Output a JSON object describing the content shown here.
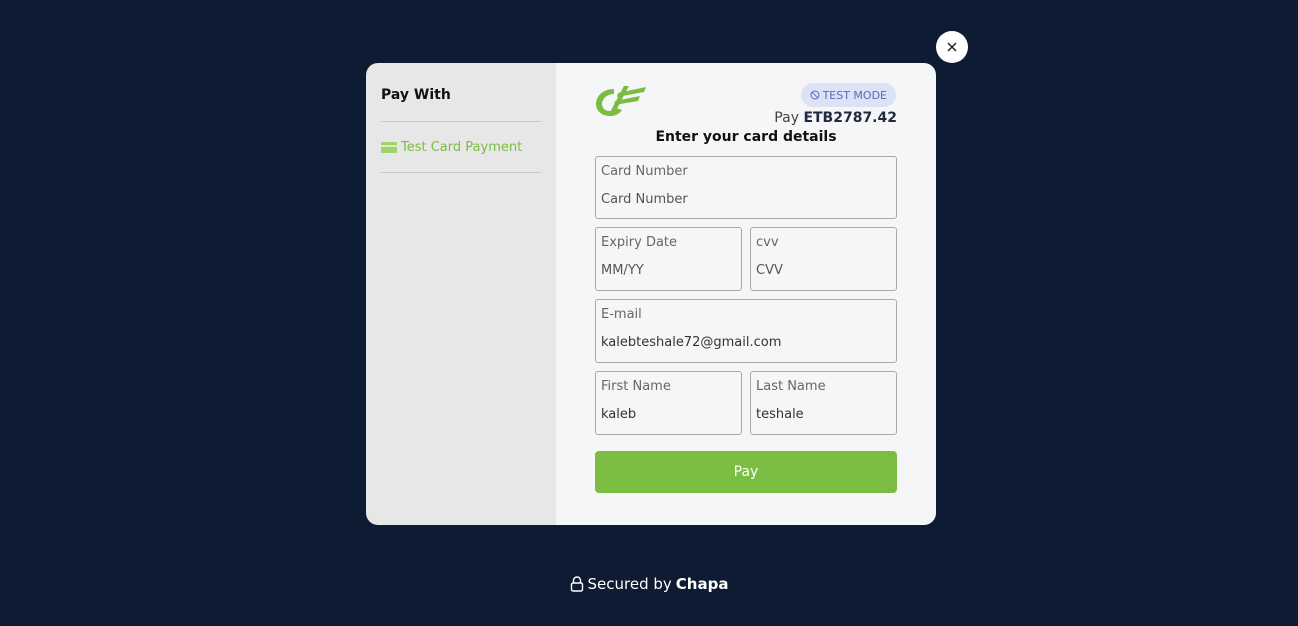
{
  "close": {
    "icon": "close-icon"
  },
  "sidebar": {
    "title": "Pay With",
    "methods": [
      {
        "label": "Test Card Payment",
        "icon": "credit-card-icon"
      }
    ]
  },
  "header": {
    "badge": "TEST MODE",
    "pay_prefix": "Pay",
    "amount": "ETB2787.42",
    "title": "Enter your card details"
  },
  "form": {
    "card_number": {
      "label": "Card Number",
      "placeholder": "Card Number",
      "value": ""
    },
    "expiry": {
      "label": "Expiry Date",
      "placeholder": "MM/YY",
      "value": ""
    },
    "cvv": {
      "label": "cvv",
      "placeholder": "CVV",
      "value": ""
    },
    "email": {
      "label": "E-mail",
      "placeholder": "",
      "value": "kalebteshale72@gmail.com"
    },
    "first_name": {
      "label": "First Name",
      "placeholder": "",
      "value": "kaleb"
    },
    "last_name": {
      "label": "Last Name",
      "placeholder": "",
      "value": "teshale"
    },
    "submit_label": "Pay"
  },
  "footer": {
    "prefix": "Secured by",
    "brand": "Chapa"
  },
  "colors": {
    "background": "#0d1b33",
    "accent": "#7bbd42",
    "badge_bg": "#dde2f6",
    "badge_text": "#5b6bb8"
  }
}
